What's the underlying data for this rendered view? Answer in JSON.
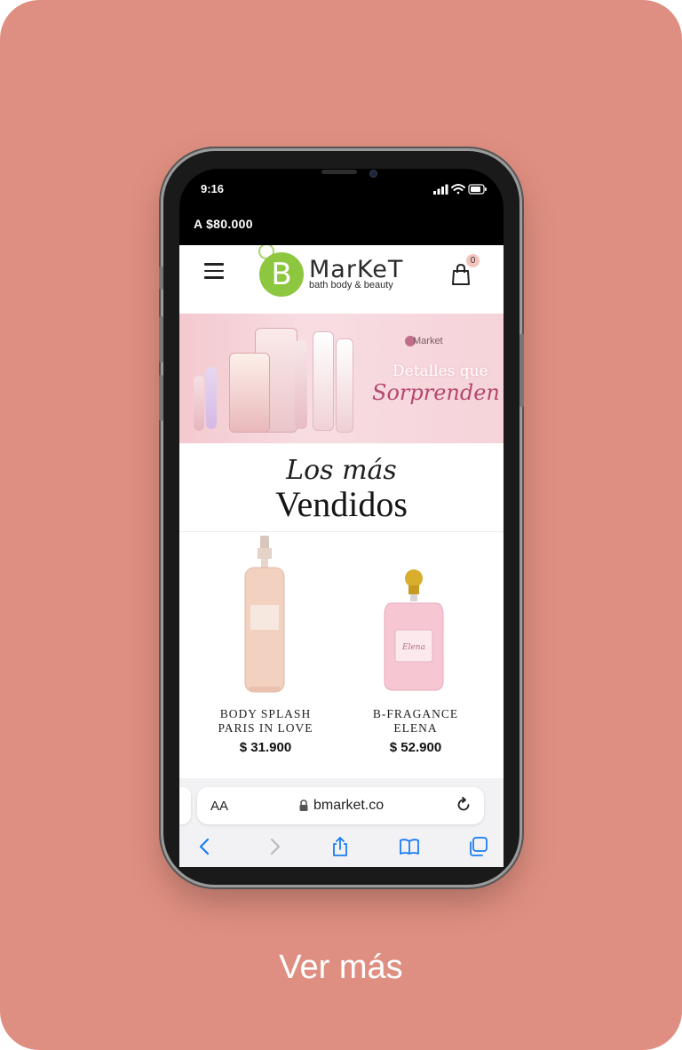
{
  "status_bar": {
    "time": "9:16"
  },
  "promo_bar": {
    "text": "A $80.000"
  },
  "site": {
    "logo_letter": "B",
    "logo_name": "MarKeT",
    "logo_tagline": "bath body & beauty",
    "cart_count": "0"
  },
  "banner": {
    "brand": "Market",
    "line1": "Detalles que",
    "line2": "Sorprenden"
  },
  "section": {
    "title_script": "Los más",
    "title_main": "Vendidos"
  },
  "products": [
    {
      "name_line1": "BODY SPLASH",
      "name_line2": "PARIS IN LOVE",
      "price": "$ 31.900"
    },
    {
      "name_line1": "B-FRAGANCE",
      "name_line2": "ELENA",
      "price": "$ 52.900"
    }
  ],
  "browser": {
    "text_size_label": "AA",
    "url": "bmarket.co"
  },
  "cta": {
    "label": "Ver más"
  },
  "colors": {
    "background": "#df8f81",
    "brand_green": "#8dc63f",
    "safari_blue": "#1a7cf2"
  }
}
